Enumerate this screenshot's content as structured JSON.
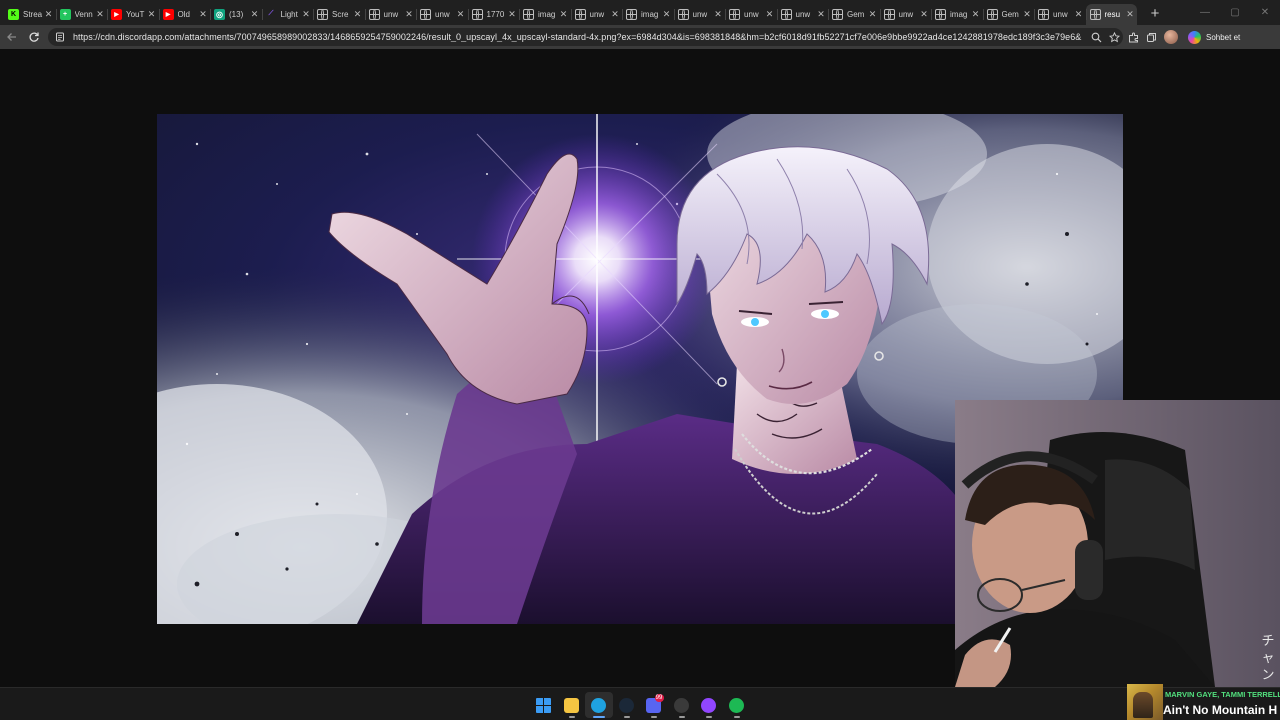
{
  "browser": {
    "tabs": [
      {
        "label": "Strea",
        "icon": "kick-icon",
        "color": "#53fc18"
      },
      {
        "label": "Venn",
        "icon": "venn-icon",
        "color": "#22c55e"
      },
      {
        "label": "YouT",
        "icon": "youtube-icon",
        "color": "#ff0000"
      },
      {
        "label": "Old",
        "icon": "youtube-icon",
        "color": "#ff0000"
      },
      {
        "label": "(13)",
        "icon": "chatgpt-icon",
        "color": "#10a37f"
      },
      {
        "label": "Light",
        "icon": "lightning-icon",
        "color": "#8b5cf6"
      },
      {
        "label": "Scre",
        "icon": "globe-icon"
      },
      {
        "label": "unw",
        "icon": "globe-icon"
      },
      {
        "label": "unw",
        "icon": "globe-icon"
      },
      {
        "label": "1770",
        "icon": "globe-icon"
      },
      {
        "label": "imag",
        "icon": "globe-icon"
      },
      {
        "label": "unw",
        "icon": "globe-icon"
      },
      {
        "label": "imag",
        "icon": "globe-icon"
      },
      {
        "label": "unw",
        "icon": "globe-icon"
      },
      {
        "label": "unw",
        "icon": "globe-icon"
      },
      {
        "label": "unw",
        "icon": "globe-icon"
      },
      {
        "label": "Gem",
        "icon": "globe-icon"
      },
      {
        "label": "unw",
        "icon": "globe-icon"
      },
      {
        "label": "imag",
        "icon": "globe-icon"
      },
      {
        "label": "Gem",
        "icon": "globe-icon"
      },
      {
        "label": "unw",
        "icon": "globe-icon"
      },
      {
        "label": "resu",
        "icon": "globe-icon",
        "active": true
      }
    ],
    "new_tab_symbol": "+",
    "close_symbol": "✕",
    "url": "https://cdn.discordapp.com/attachments/700749658989002833/1468659254759002246/result_0_upscayl_4x_upscayl-standard-4x.png?ex=6984d304&is=698381848&hm=b2cf6018d91fb52271cf7e006e9bbe9922ad4ce1242881978edc189f3c3e79e6&",
    "copilot_label": "Sohbet et"
  },
  "webcam_overlay_text": "チャン",
  "now_playing": {
    "artist": "MARVIN GAYE, TAMMI TERRELL",
    "title": "Ain't No Mountain H"
  },
  "taskbar": {
    "apps": [
      {
        "name": "start-button",
        "color": "#3b9cf5"
      },
      {
        "name": "file-explorer-app",
        "color": "#f5c542"
      },
      {
        "name": "edge-app",
        "color": "#1fa2e0"
      },
      {
        "name": "steam-app",
        "color": "#1b2838"
      },
      {
        "name": "discord-app",
        "color": "#5865f2",
        "badge": "99"
      },
      {
        "name": "obs-app",
        "color": "#3a3a3a"
      },
      {
        "name": "twitch-studio-app",
        "color": "#9146ff"
      },
      {
        "name": "spotify-app",
        "color": "#1db954"
      }
    ]
  },
  "colors": {
    "browser_chrome": "#202020",
    "toolbar": "#3a3a3a",
    "page_background": "#0e0e0e",
    "image_glow": "#b46dff",
    "spotify_green": "#52e07e"
  }
}
